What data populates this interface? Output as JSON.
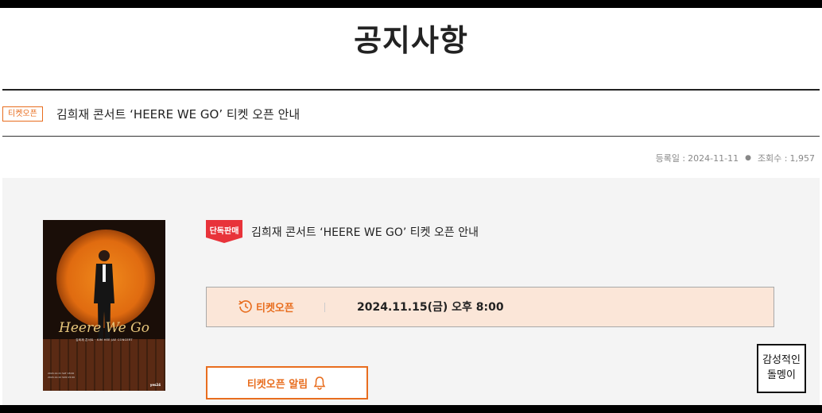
{
  "page": {
    "title": "공지사항"
  },
  "notice": {
    "category": "티켓오픈",
    "subject": "김희재 콘서트 ‘HEERE WE GO’ 티켓 오픈 안내",
    "meta": {
      "date_label": "등록일 :",
      "date": "2024-11-11",
      "views_label": "조회수 :",
      "views": "1,957"
    }
  },
  "detail": {
    "badge": "단독판매",
    "title": "김희재 콘서트 ‘HEERE WE GO’ 티켓 오픈 안내",
    "poster": {
      "script_title": "Heere We Go",
      "subtitle": "김희재 콘서트 · KIM HEE JAE CONCERT",
      "info_lines": [
        "2024.12.21 SAT 18:00",
        "2024.12.22 SUN 15:00"
      ],
      "logo": "yes24"
    },
    "ticket_open": {
      "label": "티켓오픈",
      "date": "2024.11.15(금) 오후 8:00"
    },
    "alarm_button": "티켓오픈 알림"
  },
  "floating_widget": {
    "line1": "감성적인",
    "line2": "돌멩이"
  },
  "colors": {
    "accent": "#e86d1e",
    "badge_red": "#e8333a",
    "open_box_bg": "#fbe6d8",
    "content_bg": "#f4f4f4"
  }
}
